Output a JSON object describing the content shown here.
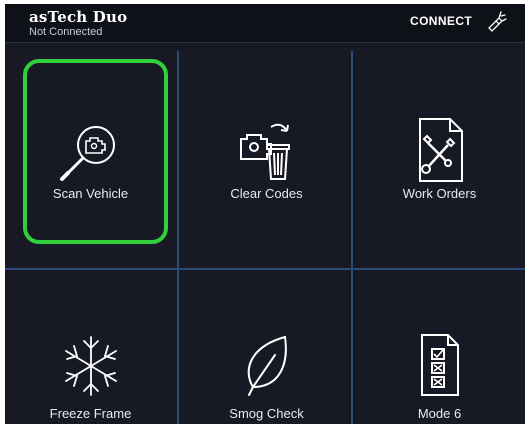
{
  "header": {
    "app_name": "asTech Duo",
    "status": "Not Connected",
    "connect_label": "CONNECT",
    "tool_icon": "flashlight-icon"
  },
  "tiles": [
    {
      "label": "Scan Vehicle",
      "icon": "scan-engine-icon",
      "selected": true
    },
    {
      "label": "Clear Codes",
      "icon": "clear-codes-icon",
      "selected": false
    },
    {
      "label": "Work Orders",
      "icon": "work-orders-icon",
      "selected": false
    },
    {
      "label": "Freeze Frame",
      "icon": "snowflake-icon",
      "selected": false
    },
    {
      "label": "Smog Check",
      "icon": "leaf-icon",
      "selected": false
    },
    {
      "label": "Mode 6",
      "icon": "checklist-icon",
      "selected": false
    }
  ],
  "colors": {
    "background": "#171a24",
    "topbar": "#0f1118",
    "divider": "#2d4a7a",
    "highlight": "#2fd03a",
    "text": "#e8eaef"
  }
}
